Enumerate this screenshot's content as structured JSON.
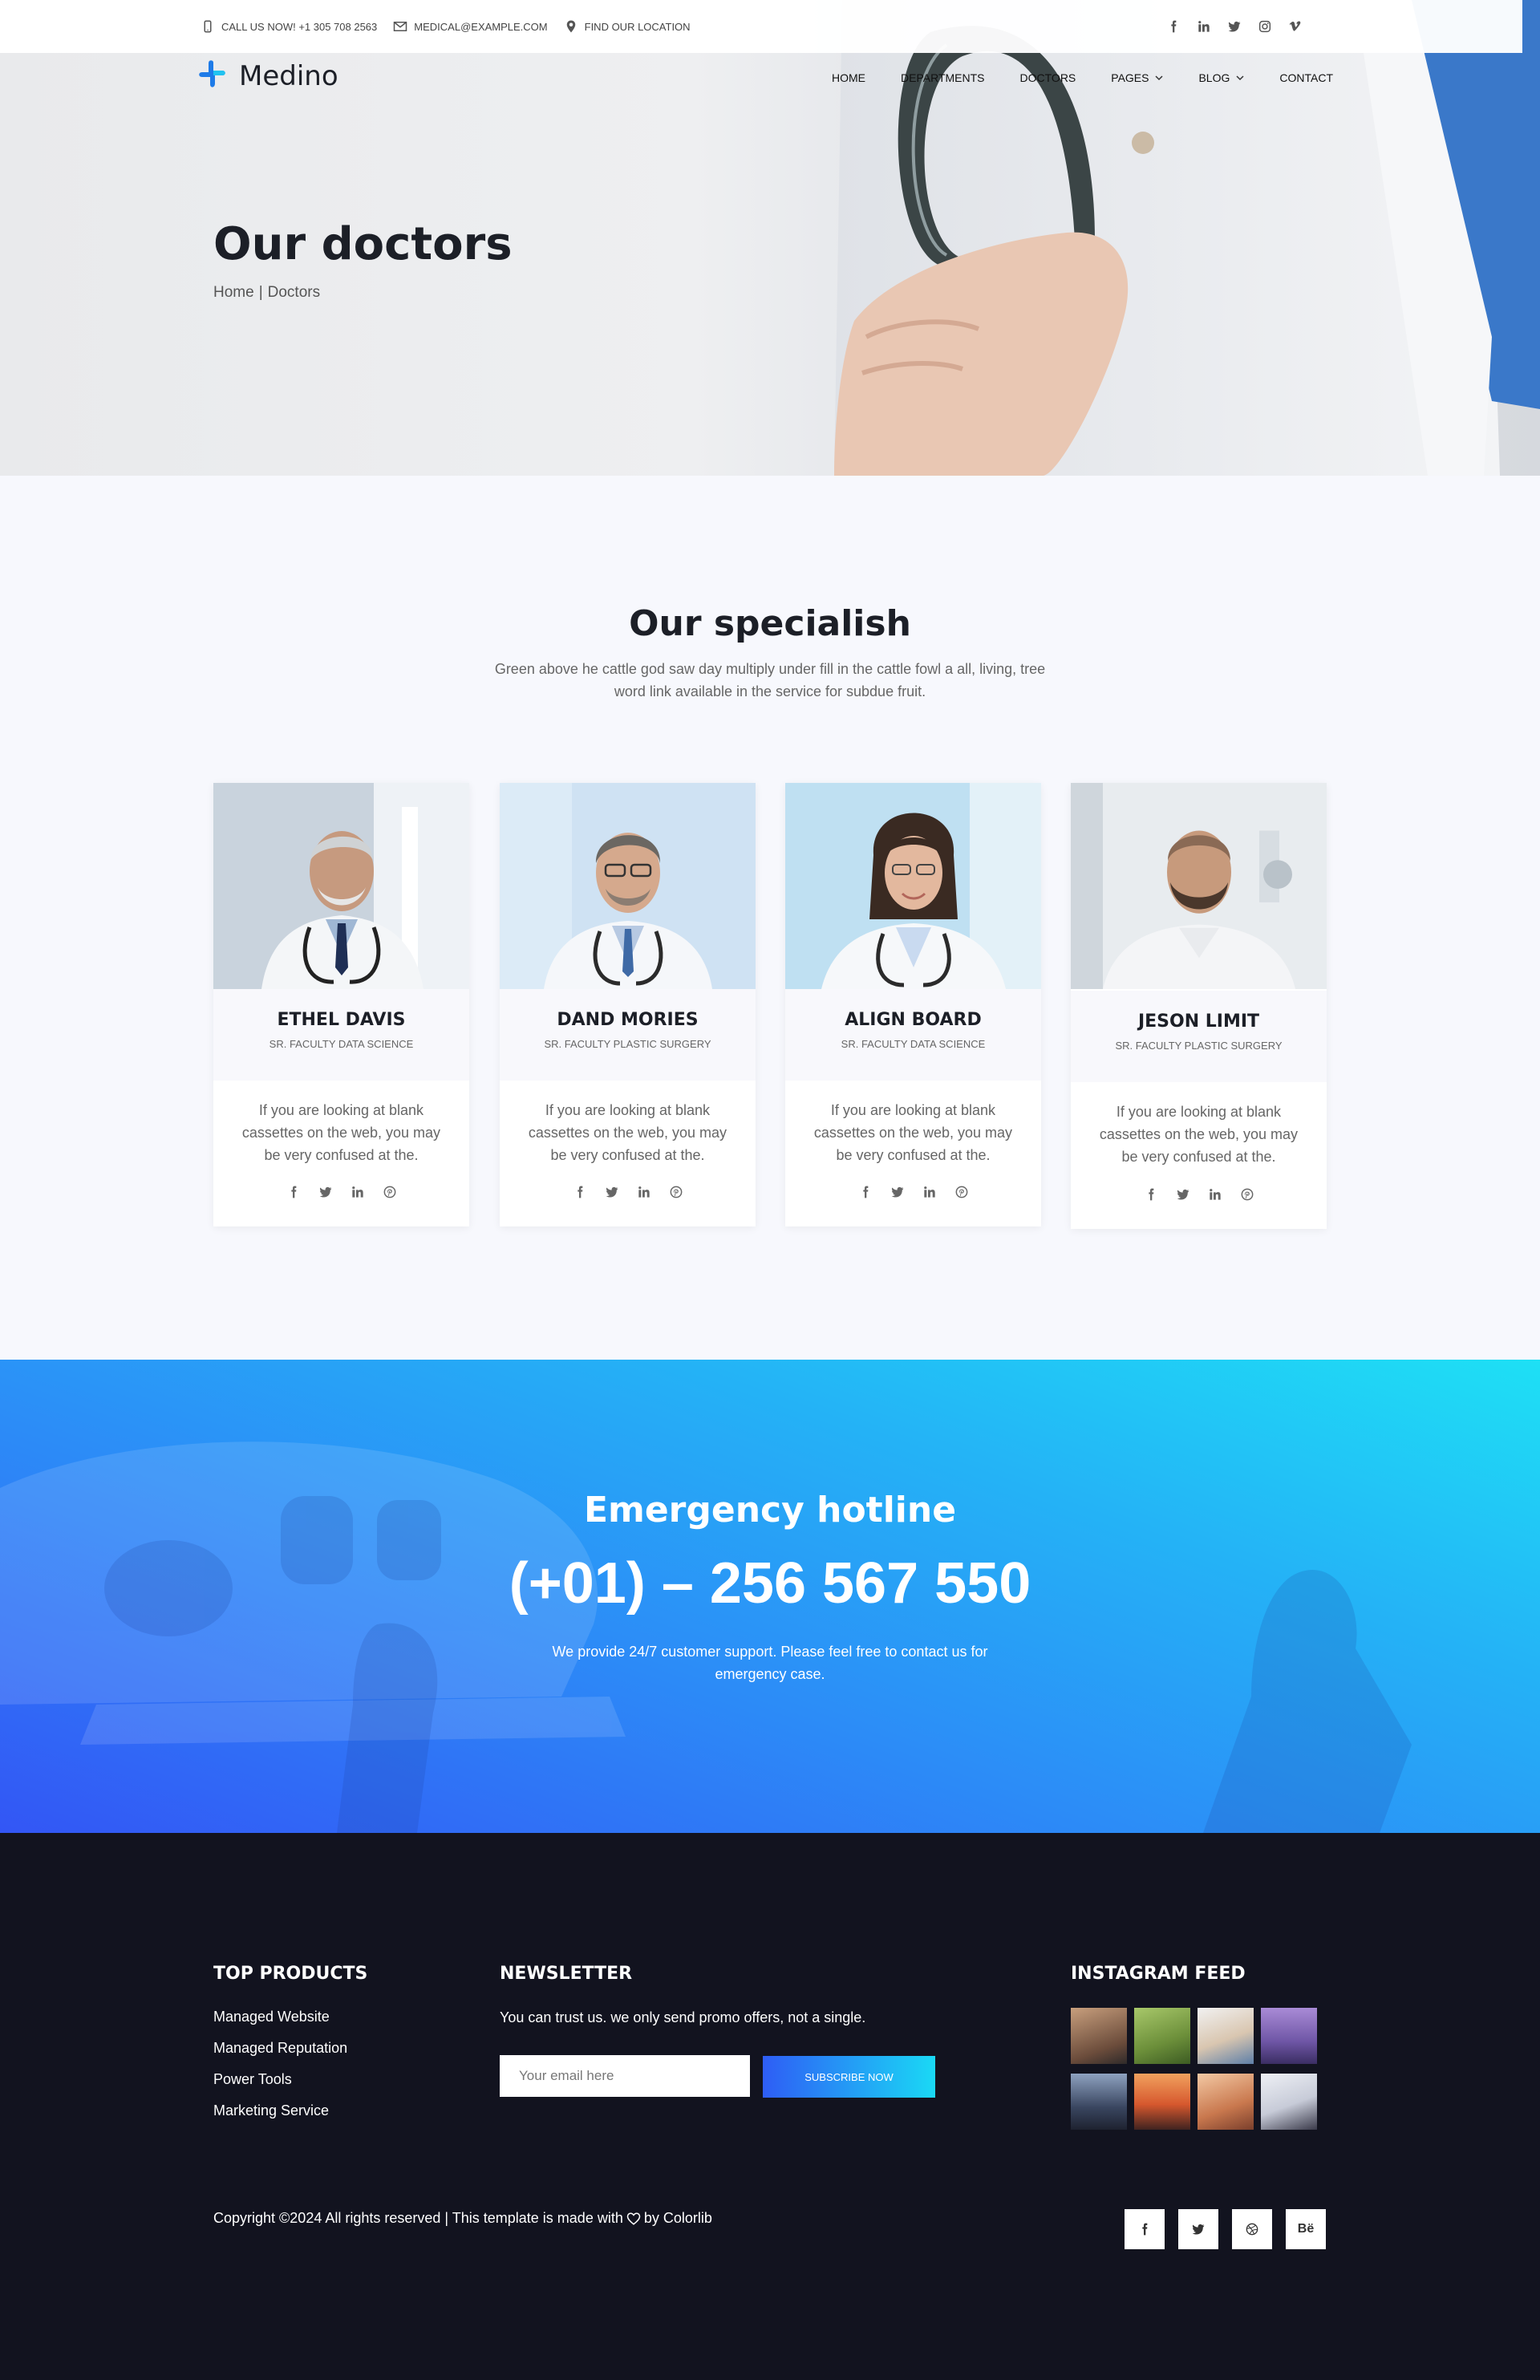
{
  "topbar": {
    "phone": "CALL US NOW! +1 305 708 2563",
    "email": "MEDICAL@EXAMPLE.COM",
    "location": "FIND OUR LOCATION",
    "social": [
      "facebook-icon",
      "linkedin-icon",
      "twitter-icon",
      "instagram-icon",
      "vimeo-icon"
    ]
  },
  "brand": {
    "name": "Medino",
    "accent": "#1e7be8"
  },
  "nav": {
    "home": "HOME",
    "departments": "DEPARTMENTS",
    "doctors": "DOCTORS",
    "pages": "PAGES",
    "blog": "BLOG",
    "contact": "CONTACT"
  },
  "hero": {
    "title": "Our doctors",
    "breadcrumb_home": "Home",
    "breadcrumb_sep": "|",
    "breadcrumb_current": "Doctors"
  },
  "specialists": {
    "title": "Our specialish",
    "subtitle": "Green above he cattle god saw day multiply under fill in the cattle fowl a all, living, tree word link available in the service for subdue fruit.",
    "doctors": [
      {
        "name": "ETHEL DAVIS",
        "role": "SR. FACULTY DATA SCIENCE",
        "text": "If you are looking at blank cassettes on the web, you may be very confused at the."
      },
      {
        "name": "DAND MORIES",
        "role": "SR. FACULTY PLASTIC SURGERY",
        "text": "If you are looking at blank cassettes on the web, you may be very confused at the."
      },
      {
        "name": "ALIGN BOARD",
        "role": "SR. FACULTY DATA SCIENCE",
        "text": "If you are looking at blank cassettes on the web, you may be very confused at the."
      },
      {
        "name": "JESON LIMIT",
        "role": "SR. FACULTY PLASTIC SURGERY",
        "text": "If you are looking at blank cassettes on the web, you may be very confused at the."
      }
    ]
  },
  "emergency": {
    "title": "Emergency hotline",
    "phone": "(+01) – 256 567 550",
    "text": "We provide 24/7 customer support. Please feel free to contact us for emergency case.",
    "gradient": [
      "#1ee0f5",
      "#3356f5"
    ]
  },
  "footer": {
    "top_products_title": "TOP PRODUCTS",
    "products": [
      "Managed Website",
      "Managed Reputation",
      "Power Tools",
      "Marketing Service"
    ],
    "newsletter_title": "NEWSLETTER",
    "newsletter_text": "You can trust us. we only send promo offers, not a single.",
    "email_placeholder": "Your email here",
    "subscribe_label": "SUBSCRIBE NOW",
    "instagram_title": "INSTAGRAM FEED",
    "copyright_pre": "Copyright ©2024 All rights reserved | This template is made with",
    "copyright_post": "by Colorlib",
    "social": [
      "facebook-icon",
      "twitter-icon",
      "dribbble-icon",
      "behance-icon"
    ],
    "behance_label": "Bë",
    "background": "#12131f"
  }
}
